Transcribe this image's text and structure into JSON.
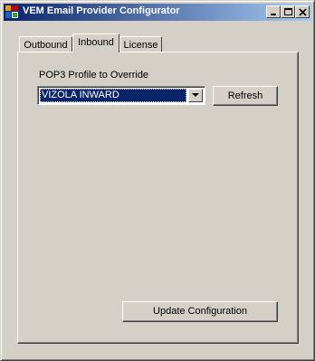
{
  "window": {
    "title": "VEM Email Provider Configurator"
  },
  "tabs": [
    {
      "label": "Outbound",
      "active": false
    },
    {
      "label": "Inbound",
      "active": true
    },
    {
      "label": "License",
      "active": false
    }
  ],
  "inbound": {
    "profile_label": "POP3 Profile to Override",
    "profile_selected": "VIZOLA INWARD",
    "refresh_label": "Refresh",
    "update_label": "Update Configuration"
  },
  "colors": {
    "titlebar_start": "#0a246a",
    "titlebar_end": "#a6caf0",
    "selection": "#0a246a",
    "face": "#d4d0c8"
  },
  "icons": {
    "app": "app-icon",
    "minimize": "minimize-icon",
    "maximize": "maximize-icon",
    "close": "close-icon",
    "dropdown": "chevron-down-icon"
  }
}
